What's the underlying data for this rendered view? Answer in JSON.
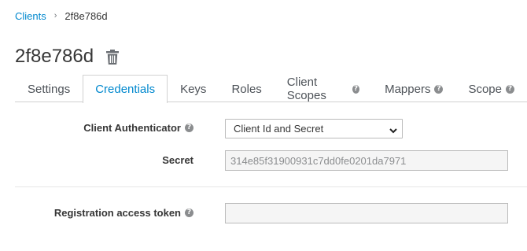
{
  "breadcrumb": {
    "parent": "Clients",
    "current": "2f8e786d"
  },
  "page": {
    "title": "2f8e786d"
  },
  "tabs": [
    {
      "label": "Settings",
      "active": false,
      "help": false
    },
    {
      "label": "Credentials",
      "active": true,
      "help": false
    },
    {
      "label": "Keys",
      "active": false,
      "help": false
    },
    {
      "label": "Roles",
      "active": false,
      "help": false
    },
    {
      "label": "Client Scopes",
      "active": false,
      "help": true
    },
    {
      "label": "Mappers",
      "active": false,
      "help": true
    },
    {
      "label": "Scope",
      "active": false,
      "help": true
    }
  ],
  "form": {
    "authenticator_label": "Client Authenticator",
    "authenticator_value": "Client Id and Secret",
    "secret_label": "Secret",
    "secret_value": "314e85f31900931c7dd0fe0201da7971",
    "registration_label": "Registration access token",
    "registration_value": ""
  },
  "icons": {
    "delete": "trash-icon",
    "help": "question-circle-icon",
    "dropdown": "chevron-down-icon"
  },
  "colors": {
    "link": "#0088ce",
    "text": "#363636",
    "border": "#d1d1d1"
  }
}
